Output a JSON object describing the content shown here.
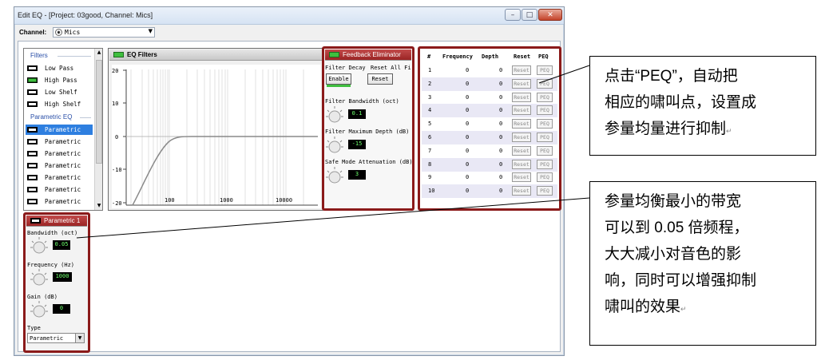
{
  "window": {
    "title": "Edit EQ - [Project: 03good, Channel: Mics]"
  },
  "channel": {
    "label": "Channel:",
    "value": "Mics"
  },
  "filters": {
    "sections": [
      {
        "header": "Filters",
        "items": [
          {
            "label": "Low Pass",
            "enabled": false
          },
          {
            "label": "High Pass",
            "enabled": true
          },
          {
            "label": "Low Shelf",
            "enabled": false
          },
          {
            "label": "High Shelf",
            "enabled": false
          }
        ]
      },
      {
        "header": "Parametric EQ",
        "items": [
          {
            "label": "Parametric",
            "enabled": false,
            "selected": true
          },
          {
            "label": "Parametric",
            "enabled": false
          },
          {
            "label": "Parametric",
            "enabled": false
          },
          {
            "label": "Parametric",
            "enabled": false
          },
          {
            "label": "Parametric",
            "enabled": false
          },
          {
            "label": "Parametric",
            "enabled": false
          },
          {
            "label": "Parametric",
            "enabled": false
          }
        ]
      }
    ]
  },
  "eq_panel": {
    "title": "EQ Filters",
    "y_ticks": [
      "20",
      "10",
      "0",
      "-10",
      "-20"
    ],
    "x_ticks": [
      "100",
      "1000",
      "10000"
    ]
  },
  "feedback": {
    "title": "Feedback Eliminator",
    "filter_decay_label": "Filter Decay",
    "reset_all_label": "Reset All Fi",
    "enable_button": "Enable",
    "reset_button": "Reset",
    "bandwidth_label": "Filter Bandwidth (oct)",
    "bandwidth_value": "0.1",
    "max_depth_label": "Filter Maximum Depth (dB)",
    "max_depth_value": "-15",
    "safe_mode_label": "Safe Mode Attenuation (dB)",
    "safe_mode_value": "3"
  },
  "table": {
    "headers": [
      "#",
      "Frequency",
      "Depth",
      "Reset",
      "PEQ"
    ],
    "reset_label": "Reset",
    "peq_label": "PEQ",
    "rows": [
      {
        "n": "1",
        "freq": "0",
        "depth": "0"
      },
      {
        "n": "2",
        "freq": "0",
        "depth": "0"
      },
      {
        "n": "3",
        "freq": "0",
        "depth": "0"
      },
      {
        "n": "4",
        "freq": "0",
        "depth": "0"
      },
      {
        "n": "5",
        "freq": "0",
        "depth": "0"
      },
      {
        "n": "6",
        "freq": "0",
        "depth": "0"
      },
      {
        "n": "7",
        "freq": "0",
        "depth": "0"
      },
      {
        "n": "8",
        "freq": "0",
        "depth": "0"
      },
      {
        "n": "9",
        "freq": "0",
        "depth": "0"
      },
      {
        "n": "10",
        "freq": "0",
        "depth": "0"
      }
    ]
  },
  "parametric": {
    "title": "Parametric 1",
    "bandwidth_label": "Bandwidth (oct)",
    "bandwidth_value": "0.05",
    "frequency_label": "Frequency (Hz)",
    "frequency_value": "1000",
    "gain_label": "Gain (dB)",
    "gain_value": "0",
    "type_label": "Type",
    "type_value": "Parametric"
  },
  "callouts": {
    "peq_note": [
      "点击“PEQ”，自动把",
      "相应的啸叫点，设置成",
      "参量均量进行抑制"
    ],
    "bandwidth_note": [
      "参量均衡最小的带宽",
      "可以到 0.05 倍频程，",
      "大大减小对音色的影",
      "响，同时可以增强抑制",
      "啸叫的效果"
    ]
  },
  "colors": {
    "accent_red": "#8b1a1a",
    "led_green": "#3fbf3f",
    "selection_blue": "#2e7fe0",
    "lcd_green": "#6cff6c"
  }
}
